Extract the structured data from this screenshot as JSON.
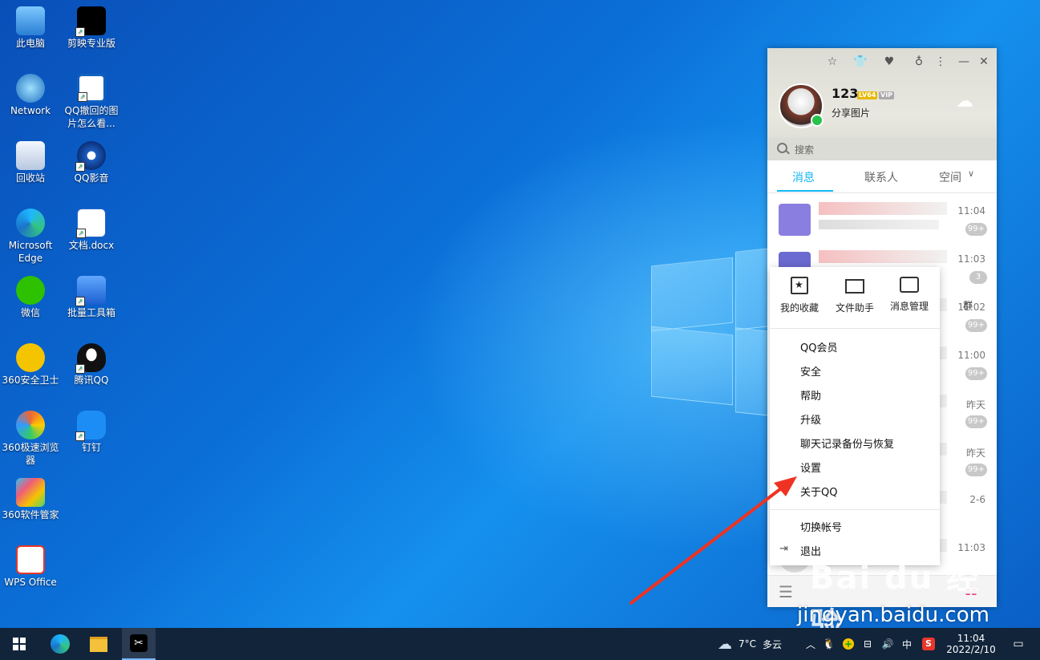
{
  "desktop": {
    "icons_left": [
      {
        "label": "此电脑",
        "icon": "computer-icon"
      },
      {
        "label": "Network",
        "icon": "network-icon"
      },
      {
        "label": "回收站",
        "icon": "recycle-bin-icon"
      },
      {
        "label": "Microsoft Edge",
        "icon": "edge-icon"
      },
      {
        "label": "微信",
        "icon": "wechat-icon"
      },
      {
        "label": "360安全卫士",
        "icon": "360-security-icon"
      },
      {
        "label": "360极速浏览器",
        "icon": "360-browser-icon"
      },
      {
        "label": "360软件管家",
        "icon": "360-software-icon"
      },
      {
        "label": "WPS Office",
        "icon": "wps-icon"
      }
    ],
    "icons_right": [
      {
        "label": "剪映专业版",
        "icon": "capcut-icon"
      },
      {
        "label": "QQ撤回的图片怎么看...",
        "icon": "video-file-icon"
      },
      {
        "label": "QQ影音",
        "icon": "qq-player-icon"
      },
      {
        "label": "文档.docx",
        "icon": "word-doc-icon"
      },
      {
        "label": "批量工具箱",
        "icon": "toolbox-icon"
      },
      {
        "label": "腾讯QQ",
        "icon": "qq-penguin-icon"
      },
      {
        "label": "钉钉",
        "icon": "dingtalk-icon"
      }
    ]
  },
  "qq": {
    "nickname": "123",
    "level_badge": "LV64",
    "vip_badge": "VIP",
    "signature": "分享图片",
    "search_placeholder": "搜索",
    "tabs": [
      "消息",
      "联系人",
      "空间"
    ],
    "messages": [
      {
        "time": "11:04",
        "badge": "99+"
      },
      {
        "time": "11:03",
        "badge": "3"
      },
      {
        "time": "11:02",
        "badge": "99+",
        "partial": "群"
      },
      {
        "time": "11:00",
        "badge": "99+"
      },
      {
        "time": "昨天",
        "badge": "99+"
      },
      {
        "time": "昨天",
        "badge": "99+"
      },
      {
        "time": "2-6",
        "badge": ""
      },
      {
        "time": "11:03",
        "badge": ""
      }
    ]
  },
  "menu": {
    "quick": [
      {
        "label": "我的收藏",
        "icon": "favorites-icon"
      },
      {
        "label": "文件助手",
        "icon": "folder-icon"
      },
      {
        "label": "消息管理",
        "icon": "message-manage-icon"
      }
    ],
    "items": [
      "QQ会员",
      "安全",
      "帮助",
      "升级",
      "聊天记录备份与恢复",
      "设置",
      "关于QQ"
    ],
    "switch_account": "切换帐号",
    "quit": "退出"
  },
  "taskbar": {
    "weather_temp": "7°C",
    "weather_desc": "多云",
    "ime": "中",
    "time": "11:04",
    "date": "2022/2/10"
  },
  "watermark": {
    "text": "Bai du 经验",
    "url": "jingyan.baidu.com"
  },
  "colors": {
    "accent": "#12b7f5",
    "arrow": "#ee3322",
    "taskbar": "#11243a"
  }
}
